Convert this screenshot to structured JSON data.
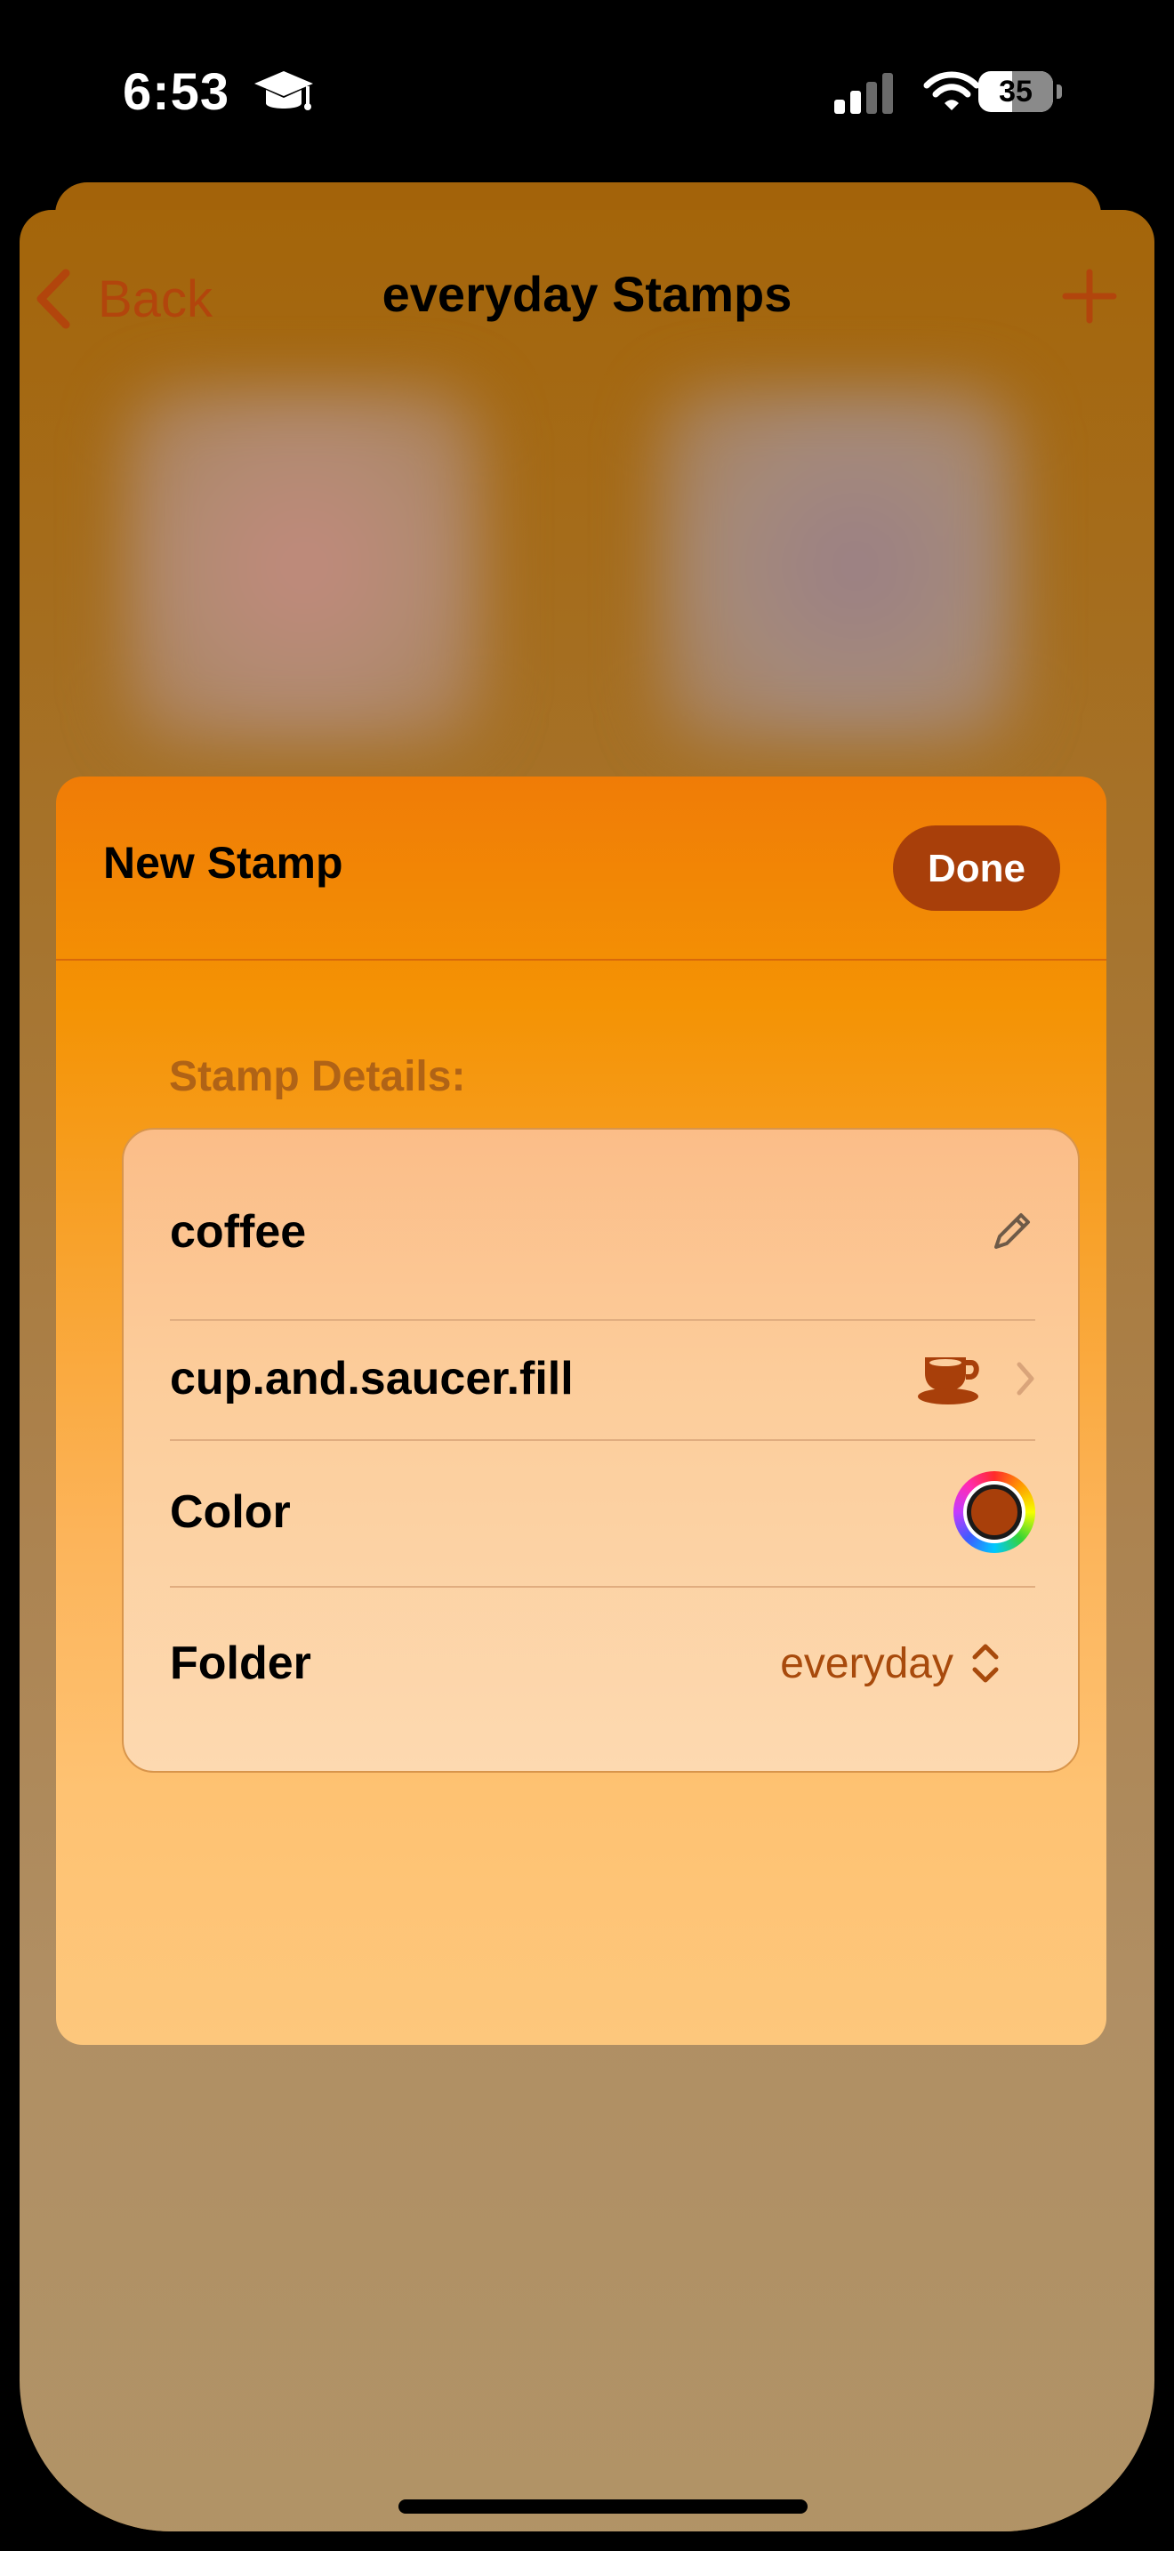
{
  "status_bar": {
    "time": "6:53",
    "battery": "35",
    "icons": [
      "graduation-cap-icon",
      "cellular-signal-icon",
      "wifi-icon",
      "battery-icon"
    ]
  },
  "nav": {
    "back_label": "Back",
    "title": "everyday Stamps",
    "add_icon": "plus-icon",
    "accent_color": "#b2450c"
  },
  "sheet": {
    "title": "New Stamp",
    "done_label": "Done",
    "section_label": "Stamp Details:",
    "rows": {
      "name": {
        "label": "coffee",
        "icon": "pencil-icon"
      },
      "symbol": {
        "label": "cup.and.saucer.fill",
        "icon": "cup-and-saucer-icon",
        "disclosure": "chevron-right-icon"
      },
      "color": {
        "label": "Color",
        "value": "#a83f0a"
      },
      "folder": {
        "label": "Folder",
        "value": "everyday",
        "icon": "chevron-up-down-icon"
      }
    }
  },
  "colors": {
    "accent": "#a83f0a",
    "sheet_top": "#f07c06",
    "sheet_bottom": "#fdc77c"
  }
}
